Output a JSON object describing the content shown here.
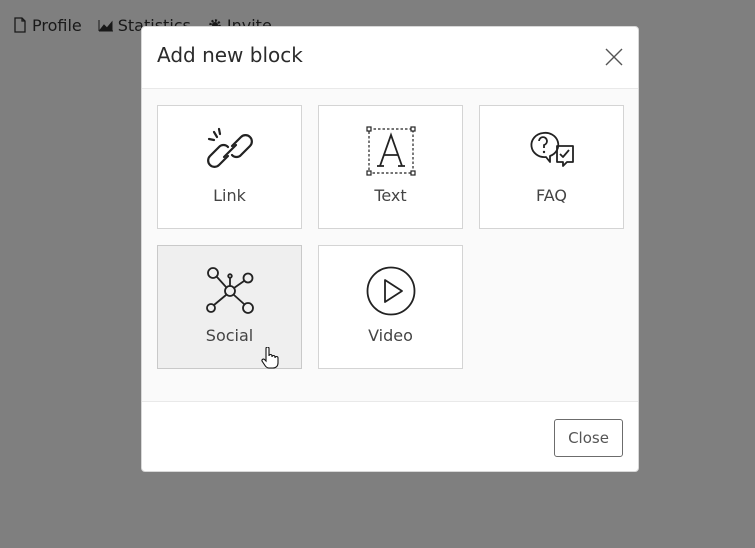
{
  "background_nav": {
    "items": [
      {
        "label": "Profile",
        "icon": "file-icon"
      },
      {
        "label": "Statistics",
        "icon": "chart-icon"
      },
      {
        "label": "Invite",
        "icon": "gear-icon"
      }
    ]
  },
  "modal": {
    "title": "Add new block",
    "close_icon": "close-icon",
    "blocks": [
      {
        "label": "Link",
        "icon": "link-icon"
      },
      {
        "label": "Text",
        "icon": "text-icon"
      },
      {
        "label": "FAQ",
        "icon": "faq-icon"
      },
      {
        "label": "Social",
        "icon": "social-icon"
      },
      {
        "label": "Video",
        "icon": "video-icon"
      }
    ],
    "close_label": "Close"
  },
  "colors": {
    "overlay": "#7f7f7f",
    "tile_hover": "#efefef",
    "border": "#d4d4d4"
  }
}
